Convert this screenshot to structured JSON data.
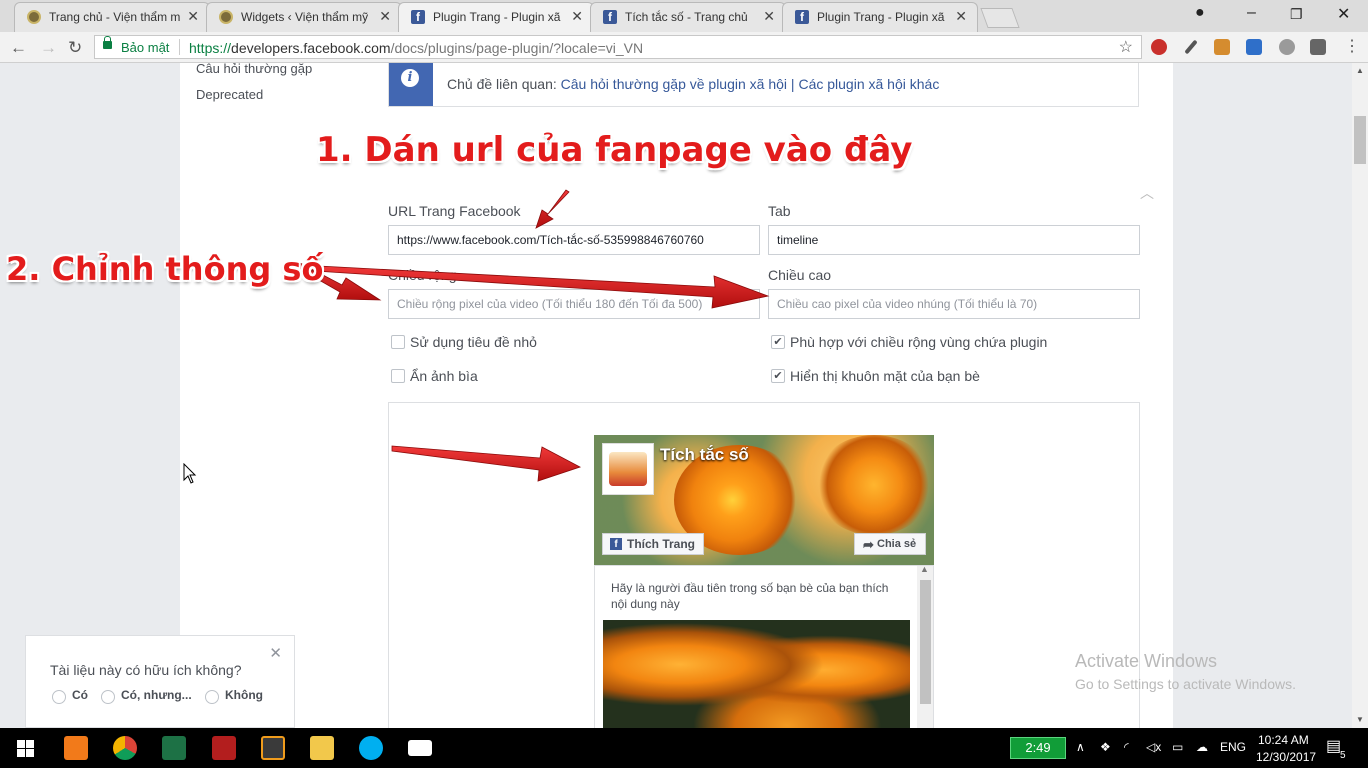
{
  "browser": {
    "tabs": [
      {
        "title": "Trang chủ - Viện thẩm m",
        "icon": "site-icon",
        "active": false
      },
      {
        "title": "Widgets ‹ Viện thẩm mỹ",
        "icon": "site-icon",
        "active": false
      },
      {
        "title": "Plugin Trang - Plugin xã",
        "icon": "facebook-icon",
        "active": true
      },
      {
        "title": "Tích tắc số - Trang chủ",
        "icon": "facebook-icon",
        "active": false
      },
      {
        "title": "Plugin Trang - Plugin xã",
        "icon": "facebook-icon",
        "active": false
      }
    ],
    "tab_close": "✕",
    "security_label": "Bảo mật",
    "url_proto": "https://",
    "url_host": "developers.facebook.com",
    "url_path": "/docs/plugins/page-plugin/?locale=vi_VN"
  },
  "sidebar": {
    "items": [
      "Câu hỏi thường gặp",
      "Deprecated"
    ]
  },
  "infobar": {
    "prefix": "Chủ đề liên quan:",
    "link1": "Câu hỏi thường gặp về plugin xã hội",
    "separator": "|",
    "link2": "Các plugin xã hội khác"
  },
  "form": {
    "url_label": "URL Trang Facebook",
    "url_value": "https://www.facebook.com/Tích-tắc-số-535998846760760",
    "tab_label": "Tab",
    "tab_value": "timeline",
    "width_label": "Chiều rộng",
    "width_placeholder": "Chiều rộng pixel của video (Tối thiểu 180 đến Tối đa 500)",
    "height_label": "Chiều cao",
    "height_placeholder": "Chiều cao pixel của video nhúng (Tối thiểu là 70)",
    "small_header_label": "Sử dụng tiêu đề nhỏ",
    "small_header_checked": false,
    "hide_cover_label": "Ẩn ảnh bìa",
    "hide_cover_checked": false,
    "adapt_width_label": "Phù hợp với chiều rộng vùng chứa plugin",
    "adapt_width_checked": true,
    "show_faces_label": "Hiển thị khuôn mặt của bạn bè",
    "show_faces_checked": true,
    "check_mark": "✔"
  },
  "plugin": {
    "page_name": "Tích tắc số",
    "like_label": "Thích Trang",
    "share_label": "Chia sẻ",
    "feed_text": "Hãy là người đầu tiên trong số bạn bè của bạn thích nội dung này"
  },
  "annotations": {
    "step1": "1. Dán url của fanpage vào đây",
    "step2": "2. Chỉnh thông số",
    "color": "#e31c1c"
  },
  "helpful": {
    "question": "Tài liệu này có hữu ích không?",
    "options": [
      "Có",
      "Có, nhưng...",
      "Không"
    ]
  },
  "watermark": {
    "line1": "Activate Windows",
    "line2": "Go to Settings to activate Windows."
  },
  "taskbar": {
    "battery_time": "2:49",
    "language": "ENG",
    "time": "10:24 AM",
    "date": "12/30/2017",
    "notifications": "5"
  }
}
